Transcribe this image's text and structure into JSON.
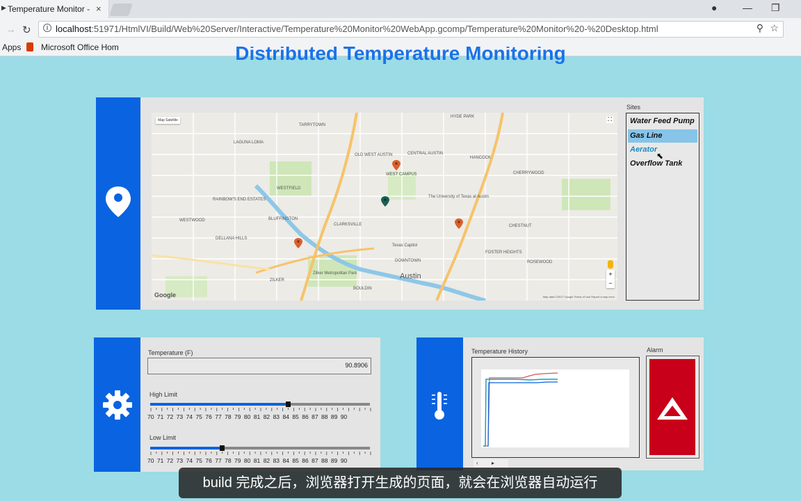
{
  "browser": {
    "tab_title": "Temperature Monitor - D",
    "tab_close": "×",
    "url_host": "localhost",
    "url_path": ":51971/HtmlVI/Build/Web%20Server/Interactive/Temperature%20Monitor%20WebApp.gcomp/Temperature%20Monitor%20-%20Desktop.html",
    "bookmarks": {
      "apps": "Apps",
      "office": "Microsoft Office Hom"
    }
  },
  "page": {
    "title": "Distributed Temperature Monitoring"
  },
  "sites": {
    "label": "Sites",
    "items": [
      "Water Feed Pump",
      "Gas Line",
      "Aerator",
      "Overflow Tank"
    ],
    "selected": "Gas Line",
    "hovered": "Aerator"
  },
  "map": {
    "type_buttons": [
      "Map",
      "Satellite"
    ],
    "google_logo": "Google",
    "footer": "Map data ©2017 Google   Terms of Use   Report a map error",
    "zoom_in": "+",
    "zoom_out": "−",
    "place_labels": [
      "HYDE PARK",
      "TARRYTOWN",
      "LAGUNA LOMA",
      "CENTRAL AUSTIN",
      "WEST CAMPUS",
      "The University of Texas at Austin",
      "WESTFIELD",
      "CLARKSVILLE",
      "DOWNTOWN",
      "Austin",
      "ZILKER",
      "BLUFFINGTON",
      "ROSEWOOD",
      "CHESTNUT",
      "HANCOCK",
      "CHERRYWOOD",
      "OLD WEST AUSTIN",
      "Texas Capitol",
      "Zilker Metropolitan Park",
      "BOULDIN",
      "WEST CAMPUS",
      "FOSTER HEIGHTS",
      "DELLANA HILLS",
      "WESTWOOD",
      "RAINBOW'S END ESTATES"
    ]
  },
  "controls": {
    "temperature_label": "Temperature (F)",
    "temperature_value": "90.8906",
    "high_limit_label": "High Limit",
    "high_limit_value": 82.5,
    "low_limit_label": "Low Limit",
    "low_limit_value": 76.5,
    "scale": [
      "70",
      "71",
      "72",
      "73",
      "74",
      "75",
      "76",
      "77",
      "78",
      "79",
      "80",
      "81",
      "82",
      "83",
      "84",
      "85",
      "86",
      "87",
      "88",
      "89",
      "90"
    ],
    "scale_min": 70,
    "scale_max": 90
  },
  "history": {
    "label": "Temperature History",
    "alarm_label": "Alarm",
    "series_colors": [
      "#d9534f",
      "#17a2b8",
      "#0a63e0"
    ]
  },
  "icons": {
    "location": "map-pin-icon",
    "settings": "gear-icon",
    "thermometer": "thermometer-icon",
    "alarm": "warning-triangle-icon"
  },
  "colors": {
    "accent_blue": "#0a63e0",
    "title_blue": "#1a73e8",
    "background": "#9bdce6",
    "alarm_red": "#c9001a"
  },
  "subtitle": "build 完成之后，浏览器打开生成的页面，就会在浏览器自动运行"
}
